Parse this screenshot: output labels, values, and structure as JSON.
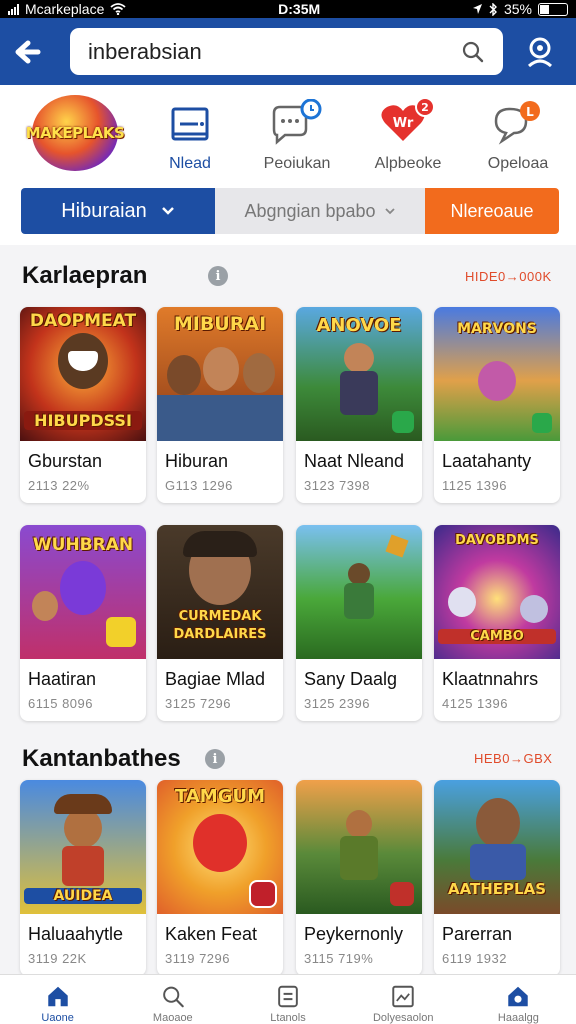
{
  "status_bar": {
    "carrier": "Mcarkeplace",
    "time": "D:35M",
    "battery": "35%"
  },
  "header": {
    "search_value": "inberabsian"
  },
  "quick_nav": {
    "logo_text": "MAKEPLAKS",
    "items": [
      {
        "label": "Nlead",
        "icon": "message-square-icon",
        "active": true
      },
      {
        "label": "Peoiukan",
        "icon": "chat-bubble-icon",
        "active": false
      },
      {
        "label": "Alpbeoke",
        "icon": "heart-notification-icon",
        "active": false
      },
      {
        "label": "Opeloaa",
        "icon": "speech-bubble-icon",
        "active": false
      }
    ]
  },
  "filters": {
    "primary": "Hiburaian",
    "secondary": "Abgngian bpabo",
    "tertiary": "Nlereoaue"
  },
  "section1": {
    "title": "Karlaepran",
    "see_all": "HIDE0→000K",
    "cards": [
      {
        "title_art": "DAOPMEAT",
        "title_art2": "HIBUPDSSI",
        "name": "Gburstan",
        "meta": "2113 22%"
      },
      {
        "title_art": "MIBURAI",
        "name": "Hiburan",
        "meta": "G113 1296"
      },
      {
        "title_art": "ANOVOE",
        "name": "Naat Nleand",
        "meta": "3123 7398"
      },
      {
        "title_art": "MARVONS",
        "name": "Laatahanty",
        "meta": "1125 1396"
      },
      {
        "title_art": "WUHBRAN",
        "name": "Haatiran",
        "meta": "6115 8096"
      },
      {
        "title_art": "CURMEDAK",
        "title_art2": "DARDLAIRES",
        "name": "Bagiae Mlad",
        "meta": "3125 7296"
      },
      {
        "title_art": "",
        "name": "Sany Daalg",
        "meta": "3125 2396"
      },
      {
        "title_art": "DAVOBDMS",
        "title_art2": "CAMBO",
        "name": "Klaatnnahrs",
        "meta": "4125 1396"
      }
    ]
  },
  "section2": {
    "title": "Kantanbathes",
    "see_all": "HEB0→GBX",
    "cards": [
      {
        "title_art": "AUIDEA",
        "name": "Haluaahytle",
        "meta": "3119 22K"
      },
      {
        "title_art": "TAMGUM",
        "name": "Kaken Feat",
        "meta": "3119 7296"
      },
      {
        "title_art": "",
        "name": "Peykernonly",
        "meta": "3115 719%"
      },
      {
        "title_art": "AATHEPLAS",
        "name": "Parerran",
        "meta": "6119 1932"
      }
    ]
  },
  "bottom_nav": [
    {
      "label": "Uaone",
      "icon": "home-icon",
      "active": true
    },
    {
      "label": "Maoaoe",
      "icon": "search-icon",
      "active": false
    },
    {
      "label": "Ltanols",
      "icon": "list-icon",
      "active": false
    },
    {
      "label": "Dolyesaolon",
      "icon": "picture-icon",
      "active": false
    },
    {
      "label": "Haaalgg",
      "icon": "account-icon",
      "active": false
    }
  ],
  "colors": {
    "brand": "#1d4ea3",
    "accent": "#f26b1d",
    "link": "#e04b2b"
  }
}
